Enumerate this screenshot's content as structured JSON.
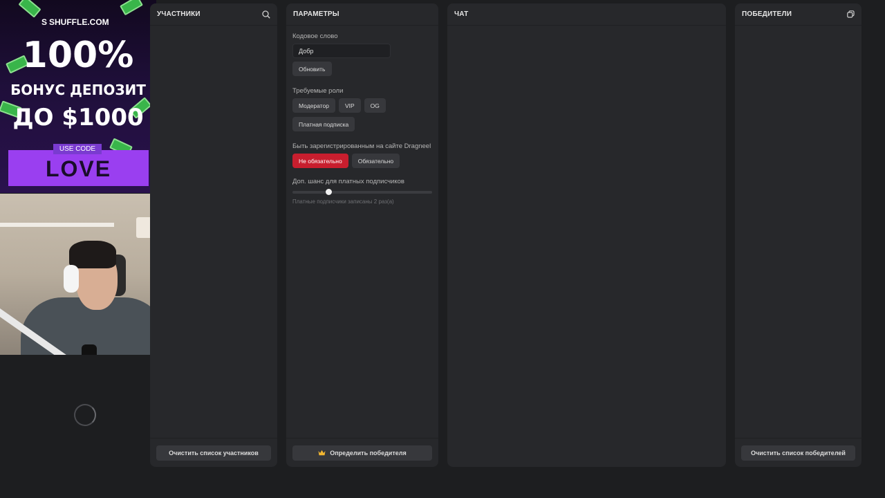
{
  "participants": {
    "title": "УЧАСТНИКИ",
    "clear_label": "Очистить список участников"
  },
  "params": {
    "title": "ПАРАМЕТРЫ",
    "keyword_label": "Кодовое слово",
    "keyword_value": "Добр",
    "update_label": "Обновить",
    "roles_label": "Требуемые роли",
    "roles": [
      "Модератор",
      "VIP",
      "OG",
      "Платная подписка"
    ],
    "registered_label": "Быть зарегистрированным на сайте Dragneel",
    "registered_options": [
      "Не обязательно",
      "Обязательно"
    ],
    "registered_selected": "Не обязательно",
    "chance_label": "Доп. шанс для платных подписчиков",
    "chance_value": 0.26,
    "chance_hint": "Платные подписчики записаны 2 раз(а)",
    "determine_label": "Определить победителя"
  },
  "chat": {
    "title": "ЧАТ"
  },
  "winners": {
    "title": "ПОБЕДИТЕЛИ",
    "clear_label": "Очистить список победителей"
  },
  "ad": {
    "brand": "SHUFFLE.COM",
    "line1": "100%",
    "line2": "БОНУС ДЕПОЗИТ",
    "line3": "ДО $1000",
    "use_code": "USE CODE",
    "code": "LOVE"
  },
  "colors": {
    "panel_bg": "#27282b",
    "page_bg": "#1d1e20",
    "accent_red": "#c81e2e",
    "button_bg": "#37383c",
    "ad_purple": "#9a3ff0"
  },
  "icons": {
    "participants_header": "search-icon",
    "winners_header": "copy-icon",
    "determine_button": "crown-icon"
  }
}
